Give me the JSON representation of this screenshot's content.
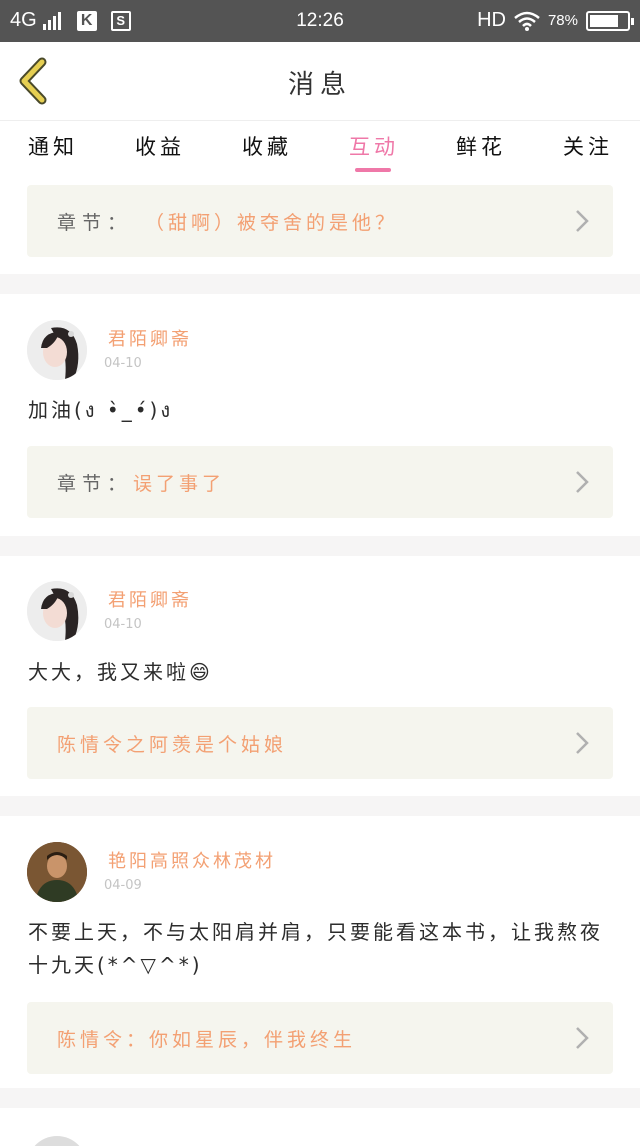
{
  "status_bar": {
    "network": "4G",
    "icon_k": "K",
    "icon_s": "S",
    "time": "12:26",
    "hd": "HD",
    "battery": "78%",
    "battery_level": 0.78
  },
  "nav": {
    "title": "消息"
  },
  "tabs": [
    {
      "label": "通知"
    },
    {
      "label": "收益"
    },
    {
      "label": "收藏"
    },
    {
      "label": "互动"
    },
    {
      "label": "鲜花"
    },
    {
      "label": "关注"
    }
  ],
  "active_tab": "互动",
  "items": [
    {
      "ref_label": "章节：",
      "ref_title": "（甜啊）被夺舍的是他？"
    },
    {
      "user": "君陌卿斋",
      "date": "04-10",
      "comment": "加油(ง •̀_•́)ง",
      "ref_label": "章节：",
      "ref_title": "误了事了"
    },
    {
      "user": "君陌卿斋",
      "date": "04-10",
      "comment": "大大，我又来啦😄",
      "ref_label": "",
      "ref_title": "陈情令之阿羡是个姑娘"
    },
    {
      "user": "艳阳高照众林茂材",
      "date": "04-09",
      "comment": "不要上天，不与太阳肩并肩，只要能看这本书，让我熬夜十九天(*^▽^*)",
      "ref_label": "",
      "ref_title": "陈情令：你如星辰，伴我终生"
    }
  ],
  "colors": {
    "accent_pink": "#ef78a8",
    "accent_orange": "#f3a073",
    "back_arrow": "#c9b13a",
    "status_bar": "#545454"
  }
}
